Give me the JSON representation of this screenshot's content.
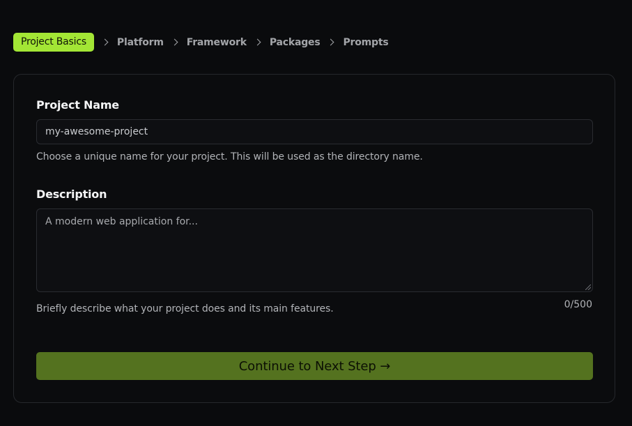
{
  "stepper": {
    "steps": [
      "Project Basics",
      "Platform",
      "Framework",
      "Packages",
      "Prompts"
    ],
    "active_index": 0
  },
  "form": {
    "project_name": {
      "label": "Project Name",
      "value": "my-awesome-project",
      "help": "Choose a unique name for your project. This will be used as the directory name."
    },
    "description": {
      "label": "Description",
      "placeholder": "A modern web application for...",
      "help": "Briefly describe what your project does and its main features.",
      "counter": "0/500"
    },
    "continue_label": "Continue to Next Step →"
  },
  "colors": {
    "accent": "#a3e635",
    "button": "#54721f",
    "background": "#0a0b0d"
  }
}
